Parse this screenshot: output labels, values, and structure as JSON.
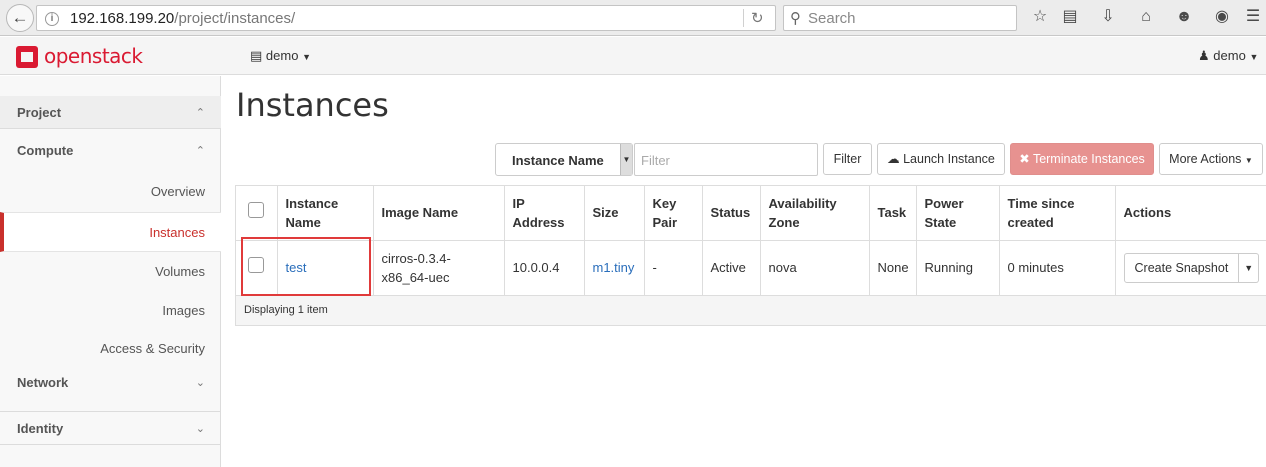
{
  "browser": {
    "url_host": "192.168.199.20",
    "url_path": "/project/instances/",
    "search_placeholder": "Search"
  },
  "header": {
    "logo_text": "openstack",
    "project": "demo",
    "user": "demo"
  },
  "sidebar": {
    "project_label": "Project",
    "compute_label": "Compute",
    "items": [
      "Overview",
      "Instances",
      "Volumes",
      "Images",
      "Access & Security"
    ],
    "network_label": "Network",
    "identity_label": "Identity"
  },
  "main": {
    "title": "Instances",
    "filter_field": "Instance Name",
    "filter_placeholder": "Filter",
    "filter_button": "Filter",
    "launch_button": "Launch Instance",
    "terminate_button": "Terminate Instances",
    "more_actions_button": "More Actions"
  },
  "table": {
    "headers": {
      "name_1": "Instance",
      "name_2": "Name",
      "image": "Image Name",
      "ip_1": "IP",
      "ip_2": "Address",
      "size": "Size",
      "key_1": "Key",
      "key_2": "Pair",
      "status": "Status",
      "az_1": "Availability",
      "az_2": "Zone",
      "task": "Task",
      "power_1": "Power",
      "power_2": "State",
      "time_1": "Time since",
      "time_2": "created",
      "actions": "Actions"
    },
    "rows": [
      {
        "name": "test",
        "image_1": "cirros-0.3.4-",
        "image_2": "x86_64-uec",
        "ip": "10.0.0.4",
        "size": "m1.tiny",
        "key_pair": "-",
        "status": "Active",
        "zone": "nova",
        "task": "None",
        "power": "Running",
        "time": "0 minutes",
        "action": "Create Snapshot"
      }
    ],
    "footer": "Displaying 1 item"
  }
}
